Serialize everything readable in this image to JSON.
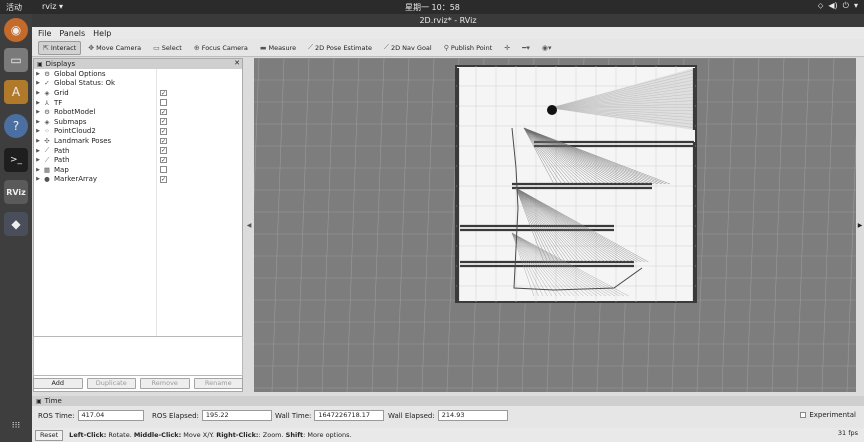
{
  "system_bar": {
    "activities": "活动",
    "app_menu": "rviz ▾",
    "clock": "星期一 10：58",
    "tray_icons": [
      "network-icon",
      "volume-icon",
      "power-icon",
      "menu-icon"
    ]
  },
  "launcher": {
    "items": [
      {
        "name": "firefox-icon",
        "glyph": "◉",
        "color": "#c46a2a"
      },
      {
        "name": "files-icon",
        "glyph": "▭",
        "color": "#7a7a7a"
      },
      {
        "name": "software-icon",
        "glyph": "A",
        "color": "#b07a2a"
      },
      {
        "name": "help-icon",
        "glyph": "?",
        "color": "#4a6fa0"
      },
      {
        "name": "terminal-icon",
        "glyph": ">_",
        "color": "#2c2c2c"
      },
      {
        "name": "rviz-icon",
        "glyph": "RViz",
        "color": "#5a5a5a"
      },
      {
        "name": "package-icon",
        "glyph": "◆",
        "color": "#556"
      },
      {
        "name": "app-grid-icon",
        "glyph": "⋮⋮⋮",
        "color": "#3e3e3e"
      }
    ]
  },
  "window": {
    "title": "2D.rviz* - RViz"
  },
  "menu": {
    "file": "File",
    "panels": "Panels",
    "help": "Help"
  },
  "toolbar": {
    "interact": "Interact",
    "move_camera": "Move Camera",
    "select": "Select",
    "focus_camera": "Focus Camera",
    "measure": "Measure",
    "pose_estimate": "2D Pose Estimate",
    "nav_goal": "2D Nav Goal",
    "publish_point": "Publish Point"
  },
  "displays": {
    "title": "Displays",
    "items": [
      {
        "label": "Global Options",
        "icon": "gear-icon",
        "glyph": "⚙",
        "check": null
      },
      {
        "label": "Global Status: Ok",
        "icon": "check-icon",
        "glyph": "✓",
        "check": null
      },
      {
        "label": "Grid",
        "icon": "grid-icon",
        "glyph": "◈",
        "check": true
      },
      {
        "label": "TF",
        "icon": "tf-icon",
        "glyph": "⅄",
        "check": false
      },
      {
        "label": "RobotModel",
        "icon": "robot-icon",
        "glyph": "⚙",
        "check": true
      },
      {
        "label": "Submaps",
        "icon": "submaps-icon",
        "glyph": "◈",
        "check": true
      },
      {
        "label": "PointCloud2",
        "icon": "pointcloud-icon",
        "glyph": "⁘",
        "check": true
      },
      {
        "label": "Landmark Poses",
        "icon": "landmark-icon",
        "glyph": "✣",
        "check": true
      },
      {
        "label": "Path",
        "icon": "path-icon",
        "glyph": "⟋",
        "check": true
      },
      {
        "label": "Path",
        "icon": "path-icon",
        "glyph": "⟋",
        "check": true
      },
      {
        "label": "Map",
        "icon": "map-icon",
        "glyph": "▦",
        "check": false
      },
      {
        "label": "MarkerArray",
        "icon": "marker-icon",
        "glyph": "●",
        "check": true
      }
    ],
    "buttons": {
      "add": "Add",
      "duplicate": "Duplicate",
      "remove": "Remove",
      "rename": "Rename"
    }
  },
  "time": {
    "title": "Time",
    "ros_time_label": "ROS Time:",
    "ros_time": "417.04",
    "ros_elapsed_label": "ROS Elapsed:",
    "ros_elapsed": "195.22",
    "wall_time_label": "Wall Time:",
    "wall_time": "1647226718.17",
    "wall_elapsed_label": "Wall Elapsed:",
    "wall_elapsed": "214.93",
    "experimental": "Experimental"
  },
  "status": {
    "reset": "Reset",
    "hint_1": "Left-Click:",
    "hint_1b": " Rotate. ",
    "hint_2": "Middle-Click:",
    "hint_2b": " Move X/Y. ",
    "hint_3": "Right-Click:",
    "hint_3b": ": Zoom. ",
    "hint_4": "Shift",
    "hint_4b": ": More options.",
    "fps": "31 fps"
  },
  "colors": {
    "grid": "#9a9a9a",
    "background": "#7d7d7d",
    "map_free": "#f5f5f5",
    "walls": "#3a3a3a"
  }
}
